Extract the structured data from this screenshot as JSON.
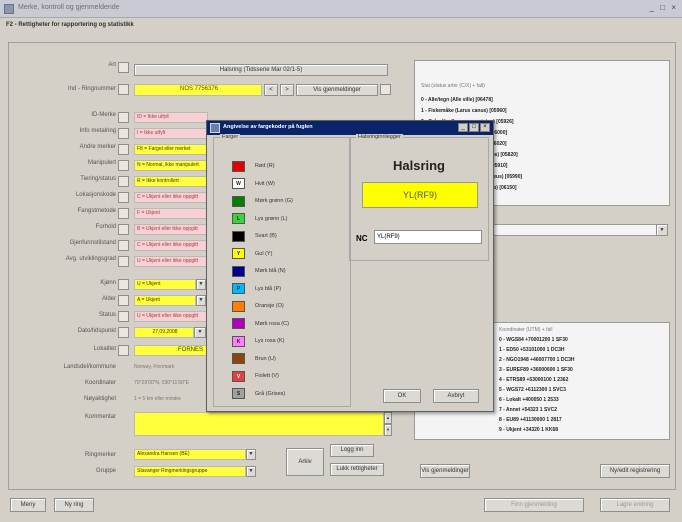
{
  "window": {
    "title": "Merke, kontroll og gjenmeldende",
    "controls": "_ □ ×"
  },
  "header": {
    "title": "F2 - Rettigheter for rapportering og statistikk"
  },
  "form_labels": [
    "Art",
    "Ind - Ringnummer",
    "ID-Merke",
    "Info metalring",
    "Andre merker",
    "Manipulert",
    "Tiering/status",
    "Lokasjonskode",
    "Fangstmetode",
    "Forhold",
    "Gjenfunnstilstand",
    "Avg. utviklingsgrad",
    "Kjønn",
    "Alder",
    "Status",
    "Dato/tidspunkt",
    "Lokalitet",
    "Landsdel/kommune",
    "Koordinater",
    "Nøyaktighet",
    "Kommentar",
    "Ringmerker",
    "Gruppe"
  ],
  "fields": {
    "art": "Halsring (Tidsserie Mar 02/1-5)",
    "ring_number": "NOS 7756376",
    "ring_btn": "Vis gjenmeldinger",
    "id_merke": "ID = Ikke utfylt",
    "info_metal": "I = Ikke utfylt",
    "andre": "F8 = Farget eller merket",
    "manip": "N = Normal, ikke manipulert",
    "tiering": "R = Ikke kontrollert",
    "lokasjon": "C = Ukjent eller ikke oppgitt",
    "fangst": "F = Ukjent",
    "forhold": "B = Ukjent eller ikke oppgitt",
    "gjenfunn": "C = Ukjent eller ikke oppgitt",
    "utvikling": "U = Ukjent eller ikke oppgitt",
    "kjonn": "U = Ukjent",
    "alder": "A = Ukjent",
    "status": "U = Ukjent eller ikke oppgitt",
    "dato": "27.09.2008",
    "lokalitet": "FORNES",
    "landsdel": "Norway, Finnmark",
    "koordinater": "70°29'00\"N, 030°11'00\"E",
    "noyaktighet": "1 = 5 km eller mindre",
    "ringmerker": "Alexandra Hansen (BE)",
    "gruppe": "Stavanger Ringmerkingsgruppe"
  },
  "right_panel": {
    "status_hint": "Stat (status arter (C/X) + fall)",
    "status_lines": [
      "0 - Alle/tegn (Alle ville) [06478]",
      "1 - Fiskemåke (Larus canus) [05960]",
      "2 - Gråmåke (Larus argentatus) [05926]",
      "3 - Svartbak (Larus marinus) [06000]",
      "4 - Krykkje (Rissa tridactyla) [06020]",
      "5 - Hettemåke (Larus ridibundus) [05820]",
      "6 - Sildemåke (Larus fuscus) [05910]",
      "7 - Polarmåke (Larus hyperboreus) [05990]",
      "8 - Makrellterne (Sterna hirundo) [06150]"
    ],
    "species_hint": "Kontroller og gjenmeldinger (C/X)",
    "coord_hint": "Koordinater (UTM) + fall",
    "coord_lines": [
      "0 - WGS84 +70001200 1 SF30",
      "1 - ED50 +53101000 1 DC3H",
      "2 - NGO1948 +46007700 1 DC3H",
      "3 - EUREF89 +36000600 1 SF30",
      "4 - ETRS89 +53000100 1 2362",
      "5 - WGS72 +6112300 1 SVC3",
      "6 - Lokalt +400050 1 2533",
      "7 - Annet +54323 1 SVC2",
      "8 - EU89 +41130000 1 2817",
      "9 - Ukjent +34320 1 KK68"
    ]
  },
  "buttons": {
    "login": "Logg inn",
    "arkiv": "Arkiv",
    "lukk": "Lukk rettigheter",
    "vis": "Vis gjenmeldinger",
    "ny": "Ny/edit registrering",
    "meny": "Meny",
    "ny2": "Ny ring",
    "finn": "Finn gjenmelding",
    "lagre": "Lagre endring"
  },
  "dialog": {
    "title": "Angivelse av fargekoder på fuglen",
    "colors_group": "Farger",
    "colors": [
      {
        "name": "Rød (R)",
        "hex": "#e00000",
        "code": ""
      },
      {
        "name": "Hvit (W)",
        "hex": "#ffffff",
        "code": "W"
      },
      {
        "name": "Mørk grønn (G)",
        "hex": "#008000",
        "code": ""
      },
      {
        "name": "Lys grønn (L)",
        "hex": "#38d438",
        "code": "L"
      },
      {
        "name": "Svart (B)",
        "hex": "#000000",
        "code": ""
      },
      {
        "name": "Gul (Y)",
        "hex": "#ffff00",
        "code": "Y"
      },
      {
        "name": "Mørk blå (N)",
        "hex": "#000090",
        "code": ""
      },
      {
        "name": "Lys blå (P)",
        "hex": "#00b8ff",
        "code": "P"
      },
      {
        "name": "Oransje (O)",
        "hex": "#ff8000",
        "code": ""
      },
      {
        "name": "Mørk rosa (C)",
        "hex": "#b400b4",
        "code": ""
      },
      {
        "name": "Lys rosa (K)",
        "hex": "#ff80ff",
        "code": "K"
      },
      {
        "name": "Brun (U)",
        "hex": "#8b4513",
        "code": ""
      },
      {
        "name": "Fiolett (V)",
        "hex": "#e04040",
        "code": "V"
      },
      {
        "name": "Grå (Grises)",
        "hex": "#a0a0a0",
        "code": "S"
      }
    ],
    "halsring_group": "Halsringinnlegger",
    "halsring_title": "Halsring",
    "halsring_code": "YL(RF9)",
    "nc_label": "NC",
    "nc_value": "YL(RF9)",
    "ok": "OK",
    "avbryt": "Avbryt"
  }
}
